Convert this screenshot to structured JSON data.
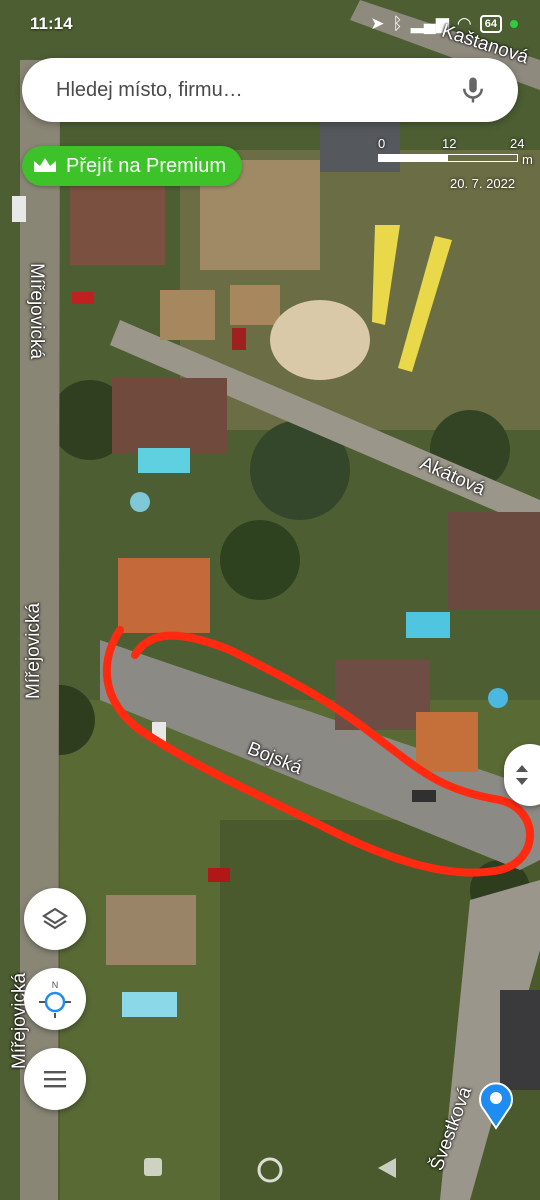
{
  "status_bar": {
    "time": "11:14",
    "battery": "64"
  },
  "search": {
    "placeholder": "Hledej místo, firmu…"
  },
  "premium": {
    "label": "Přejít na Premium"
  },
  "scale": {
    "tick0": "0",
    "tick1": "12",
    "tick2": "24",
    "unit": "m",
    "date": "20. 7. 2022"
  },
  "streets": {
    "kastanova": "Kaštanová",
    "mirejovicka_top": "Mířejovická",
    "mirejovicka_mid": "Mířejovická",
    "mirejovicka_bottom": "Mířejovická",
    "akatova": "Akátová",
    "bojska": "Bojská",
    "svestkova": "Švestková"
  },
  "icons": [
    "microphone-icon",
    "crown-icon",
    "layers-icon",
    "compass-icon",
    "menu-icon",
    "expand-icon",
    "location-pin-icon"
  ],
  "colors": {
    "premium_green": "#3ec229",
    "annotation_red": "#ff2a10",
    "pin_blue": "#1e8cf0"
  }
}
